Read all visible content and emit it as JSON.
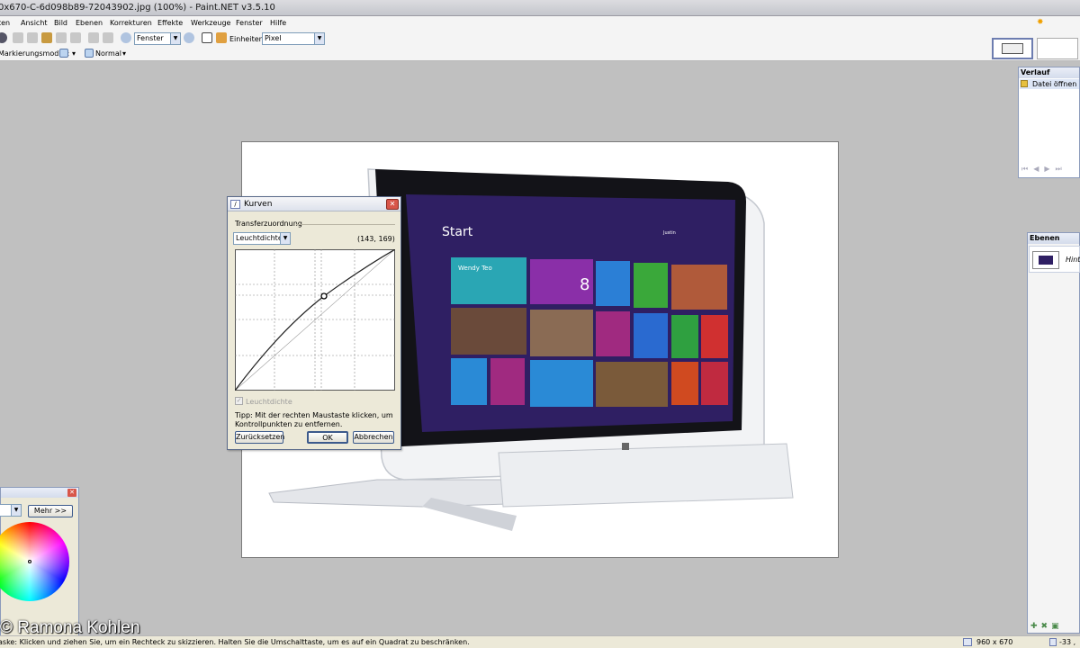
{
  "window": {
    "title": "0x670-C-6d098b89-72043902.jpg (100%) - Paint.NET v3.5.10"
  },
  "menu": [
    "ten",
    "Ansicht",
    "Bild",
    "Ebenen",
    "Korrekturen",
    "Effekte",
    "Werkzeuge",
    "Fenster",
    "Hilfe"
  ],
  "toolbar": {
    "zoom_value": "Fenster",
    "units_label": "Einheiten:",
    "units_value": "Pixel",
    "selection_mode_label": "Markierungsmodus:",
    "blend_mode_value": "Normal"
  },
  "history": {
    "title": "Verlauf",
    "items": [
      "Datei öffnen"
    ]
  },
  "layers": {
    "title": "Ebenen",
    "items": [
      "Hinte"
    ]
  },
  "curves": {
    "title": "Kurven",
    "group_label": "Transferzuordnung",
    "mode_value": "Leuchtdichte",
    "coords": "(143, 169)",
    "checkbox_label": "Leuchtdichte",
    "tip": "Tipp: Mit der rechten Maustaste klicken, um Kontrollpunkten zu entfernen.",
    "reset_button": "Zurücksetzen",
    "ok_button": "OK",
    "cancel_button": "Abbrechen"
  },
  "colors": {
    "more_button": "Mehr >>"
  },
  "screen": {
    "start_label": "Start",
    "tile_user": "Wendy Teo",
    "tile_calendar_number": "8",
    "account_name": "Justin"
  },
  "status": {
    "hint": "aske: Klicken und ziehen Sie, um ein Rechteck zu skizzieren. Halten Sie die Umschalttaste, um es auf ein Quadrat zu beschränken.",
    "image_size": "960 x 670",
    "cursor_pos": "-33 ,"
  },
  "watermark": "© Ramona Kohlen"
}
